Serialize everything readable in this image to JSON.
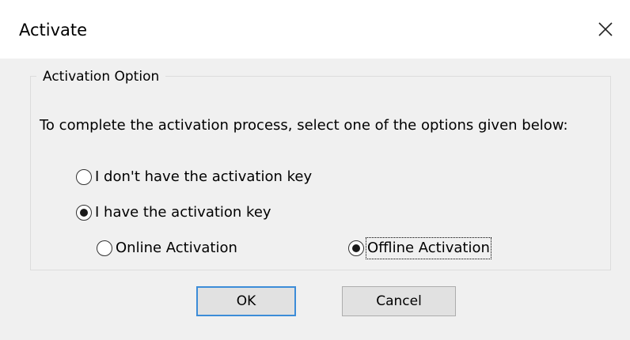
{
  "window": {
    "title": "Activate"
  },
  "group": {
    "legend": "Activation Option",
    "instruction": "To complete the activation process, select one of the options given below:"
  },
  "options": {
    "no_key": {
      "label": "I don't have the activation key",
      "selected": false
    },
    "have_key": {
      "label": "I have the activation key",
      "selected": true
    },
    "online": {
      "label": "Online Activation",
      "selected": false
    },
    "offline": {
      "label": "Offline Activation",
      "selected": true
    }
  },
  "buttons": {
    "ok": "OK",
    "cancel": "Cancel"
  },
  "colors": {
    "dialog_bg": "#f0f0f0",
    "titlebar_bg": "#ffffff",
    "default_button_border": "#3c8cd8"
  },
  "icons": {
    "close": "close-icon"
  }
}
